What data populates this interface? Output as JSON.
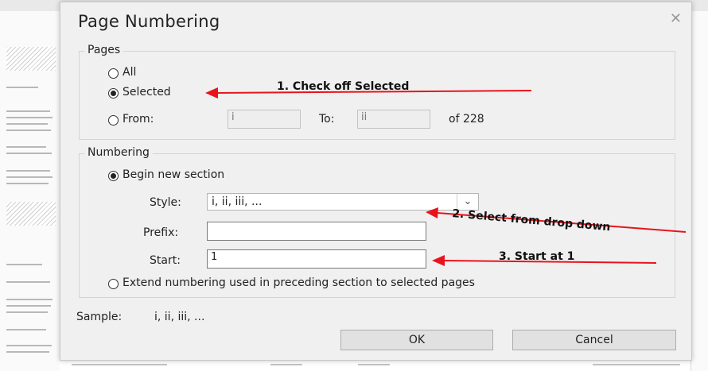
{
  "dialog": {
    "title": "Page Numbering",
    "close_glyph": "✕"
  },
  "pages": {
    "legend": "Pages",
    "all_label": "All",
    "selected_label": "Selected",
    "from_label": "From:",
    "from_value": "i",
    "to_label": "To:",
    "to_value": "ii",
    "of_text": "of 228",
    "selected_option": "Selected"
  },
  "numbering": {
    "legend": "Numbering",
    "begin_label": "Begin new section",
    "style_label": "Style:",
    "style_value": "i, ii, iii, ...",
    "prefix_label": "Prefix:",
    "prefix_value": "",
    "start_label": "Start:",
    "start_value": "1",
    "extend_label": "Extend numbering used in preceding section to selected pages",
    "selected_option": "Begin new section"
  },
  "sample": {
    "label": "Sample:",
    "value": "i, ii, iii, ..."
  },
  "buttons": {
    "ok": "OK",
    "cancel": "Cancel"
  },
  "annotations": {
    "step1": "1.  Check off Selected",
    "step2": "2. Select from drop down",
    "step3": "3. Start at 1",
    "arrow_color": "#e8141d"
  },
  "icons": {
    "close": "close-icon",
    "dropdown": "chevron-down-icon"
  }
}
